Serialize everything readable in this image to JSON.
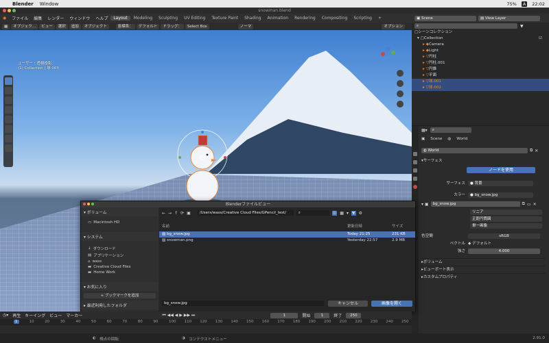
{
  "mac": {
    "apple": "",
    "app": "Blender",
    "window": "Window",
    "battery": "75%",
    "time": "22:02",
    "input": "A"
  },
  "window_title": "snowman.blend",
  "menu": [
    "ファイル",
    "編集",
    "レンダー",
    "ウィンドウ",
    "ヘルプ"
  ],
  "workspaces": [
    "Layout",
    "Modeling",
    "Sculpting",
    "UV Editing",
    "Texture Paint",
    "Shading",
    "Animation",
    "Rendering",
    "Compositing",
    "Scripting",
    "+"
  ],
  "header_right": {
    "scene": "Scene",
    "view_layer": "View Layer"
  },
  "vp_header": [
    "オブジェク…",
    "ビュー",
    "選択",
    "追加",
    "オブジェクト"
  ],
  "vp_header2": {
    "orient": "座標系：",
    "default": "デフォルト",
    "drag": "ドラッグ：",
    "select_box": "Select Box",
    "normal": "ノーマ"
  },
  "vp_options": "オプション",
  "vp_info": {
    "line1": "ユーザー・透視投影",
    "line2": "(1) Collection | 球.003"
  },
  "outliner": {
    "root": "シーンコレクション",
    "collection": "Collection",
    "items": [
      "Camera",
      "Light",
      "円柱",
      "円柱.001",
      "円錐",
      "平面",
      "球.001",
      "球.002"
    ]
  },
  "props": {
    "search_placeholder": "",
    "scene": "Scene",
    "world": "World",
    "world_name": "World",
    "surface": "サーフェス",
    "use_nodes": "ノードを使用",
    "surface_label": "サーフェス",
    "surface_val": "背景",
    "color_label": "カラー",
    "color_val": "bg_snow.jpg",
    "image_name": "bg_snow.jpg",
    "linear": "リニア",
    "equirect": "正距円筒図",
    "single": "単一画像",
    "colorspace_label": "色空間",
    "colorspace_val": "sRGB",
    "vector_label": "ベクトル",
    "vector_val": "デフォルト",
    "strength_label": "強さ",
    "strength_val": "4.000",
    "volume": "ボリューム",
    "viewport": "ビューポート表示",
    "custom": "カスタムプロパティ"
  },
  "dialog": {
    "title": "Blenderファイルビュー",
    "path": "/Users/wass/Creative Cloud Files/GPencil_test/",
    "volumes": "ボリューム",
    "volume_items": [
      "Macintosh HD"
    ],
    "system": "システム",
    "system_items": [
      "ダウンロード",
      "アプリケーション",
      "wass",
      "Creative Cloud Files",
      "Home Work"
    ],
    "bookmarks": "お気に入り",
    "add_bookmark": "ブックマークを追加",
    "recent": "最近利用したフォルダ",
    "col_name": "名前",
    "col_date": "更新日時",
    "col_size": "サイズ",
    "files": [
      {
        "name": "bg_snow.jpg",
        "date": "Today 21:25",
        "size": "231 KB"
      },
      {
        "name": "snowman.png",
        "date": "Yesterday 22:57",
        "size": "2.9 MB"
      }
    ],
    "filename": "bg_snow.jpg",
    "cancel": "キャンセル",
    "open": "画像を開く"
  },
  "timeline": {
    "menu": [
      "再生",
      "キーイング",
      "ビュー",
      "マーカー"
    ],
    "current": "1",
    "start_label": "開始",
    "start": "1",
    "end_label": "終了",
    "end": "250",
    "ticks": [
      "1",
      "10",
      "20",
      "30",
      "40",
      "50",
      "60",
      "70",
      "80",
      "90",
      "100",
      "110",
      "120",
      "130",
      "140",
      "150",
      "160",
      "170",
      "180",
      "190",
      "200",
      "210",
      "220",
      "230",
      "240",
      "250"
    ]
  },
  "status": {
    "left": "視点の回転",
    "middle": "コンテクストメニュー",
    "version": "2.91.0"
  },
  "colors": {
    "accent": "#4772b3",
    "selected_row": "#334d80",
    "orange": "#e8893a"
  }
}
